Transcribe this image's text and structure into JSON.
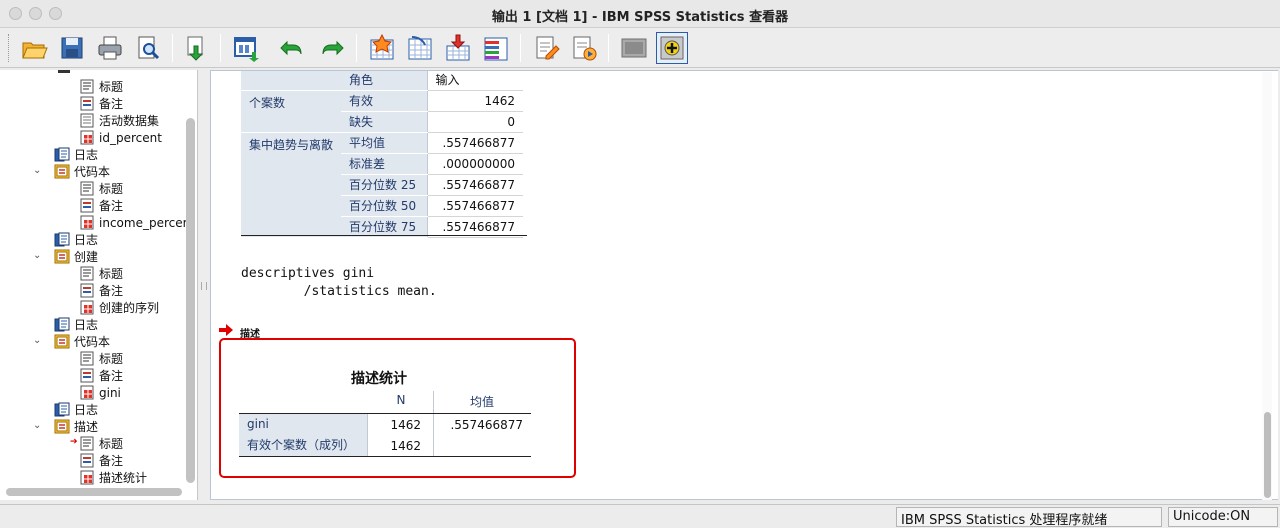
{
  "window": {
    "title": "输出 1 [文档 1] - IBM SPSS Statistics 查看器"
  },
  "toolbar": {
    "buttons": [
      {
        "name": "open-icon"
      },
      {
        "name": "save-icon"
      },
      {
        "name": "print-icon"
      },
      {
        "name": "print-preview-icon"
      },
      {
        "name": "export-icon"
      },
      {
        "name": "recall-dialog-icon"
      },
      {
        "name": "undo-icon"
      },
      {
        "name": "redo-icon"
      },
      {
        "name": "goto-data-icon"
      },
      {
        "name": "goto-case-icon"
      },
      {
        "name": "goto-variable-icon"
      },
      {
        "name": "variables-icon"
      },
      {
        "name": "run-descriptives-icon"
      },
      {
        "name": "use-variable-sets-icon"
      },
      {
        "name": "show-all-icon"
      },
      {
        "name": "insert-cases-icon"
      }
    ]
  },
  "outline": {
    "items": [
      {
        "label": "标题",
        "icon": "title-icon",
        "level": 2
      },
      {
        "label": "备注",
        "icon": "notes-icon",
        "level": 2
      },
      {
        "label": "活动数据集",
        "icon": "text-icon",
        "level": 2
      },
      {
        "label": "id_percent",
        "icon": "table-icon",
        "level": 2
      },
      {
        "label": "日志",
        "icon": "log-icon",
        "level": 1
      },
      {
        "label": "代码本",
        "icon": "procedure-icon",
        "level": 1,
        "expanded": true
      },
      {
        "label": "标题",
        "icon": "title-icon",
        "level": 2
      },
      {
        "label": "备注",
        "icon": "notes-icon",
        "level": 2
      },
      {
        "label": "income_percer",
        "icon": "table-icon",
        "level": 2
      },
      {
        "label": "日志",
        "icon": "log-icon",
        "level": 1
      },
      {
        "label": "创建",
        "icon": "procedure-icon",
        "level": 1,
        "expanded": true
      },
      {
        "label": "标题",
        "icon": "title-icon",
        "level": 2
      },
      {
        "label": "备注",
        "icon": "notes-icon",
        "level": 2
      },
      {
        "label": "创建的序列",
        "icon": "table-icon",
        "level": 2
      },
      {
        "label": "日志",
        "icon": "log-icon",
        "level": 1
      },
      {
        "label": "代码本",
        "icon": "procedure-icon",
        "level": 1,
        "expanded": true
      },
      {
        "label": "标题",
        "icon": "title-icon",
        "level": 2
      },
      {
        "label": "备注",
        "icon": "notes-icon",
        "level": 2
      },
      {
        "label": "gini",
        "icon": "table-icon",
        "level": 2
      },
      {
        "label": "日志",
        "icon": "log-icon",
        "level": 1
      },
      {
        "label": "描述",
        "icon": "procedure-icon",
        "level": 1,
        "expanded": true
      },
      {
        "label": "标题",
        "icon": "title-icon",
        "level": 2,
        "current": true
      },
      {
        "label": "备注",
        "icon": "notes-icon",
        "level": 2
      },
      {
        "label": "描述统计",
        "icon": "table-icon",
        "level": 2
      }
    ]
  },
  "stats_table": {
    "header_role_label": "角色",
    "header_role_value": "输入",
    "group1": "个案数",
    "group2": "集中趋势与离散",
    "rows": [
      {
        "label": "有效",
        "value": "1462"
      },
      {
        "label": "缺失",
        "value": "0"
      },
      {
        "label": "平均值",
        "value": ".557466877"
      },
      {
        "label": "标准差",
        "value": ".000000000"
      },
      {
        "label": "百分位数 25",
        "value": ".557466877"
      },
      {
        "label": "百分位数 50",
        "value": ".557466877"
      },
      {
        "label": "百分位数 75",
        "value": ".557466877"
      }
    ]
  },
  "syntax": {
    "line1": "descriptives gini",
    "line2": "        /statistics mean."
  },
  "descriptives": {
    "section_label": "描述",
    "title": "描述统计",
    "col_n": "N",
    "col_mean": "均值",
    "rows": [
      {
        "label": "gini",
        "n": "1462",
        "mean": ".557466877"
      },
      {
        "label": "有效个案数（成列）",
        "n": "1462",
        "mean": ""
      }
    ]
  },
  "status": {
    "processor": "IBM SPSS Statistics 处理程序就绪",
    "unicode": "Unicode:ON"
  }
}
